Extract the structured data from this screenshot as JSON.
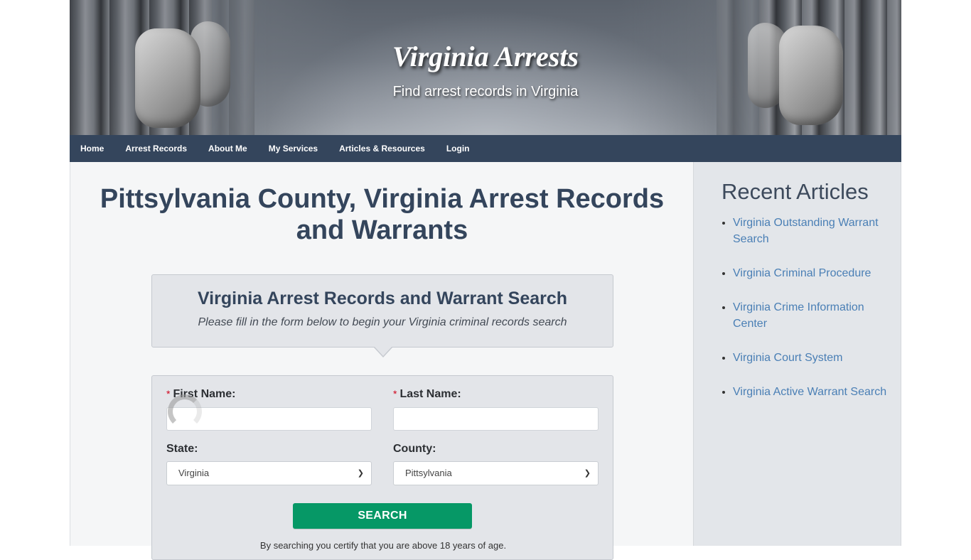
{
  "header": {
    "site_title": "Virginia Arrests",
    "tagline": "Find arrest records in Virginia"
  },
  "nav": {
    "items": [
      {
        "label": "Home"
      },
      {
        "label": "Arrest Records"
      },
      {
        "label": "About Me"
      },
      {
        "label": "My Services"
      },
      {
        "label": "Articles & Resources"
      },
      {
        "label": "Login"
      }
    ]
  },
  "main": {
    "page_title": "Pittsylvania County, Virginia Arrest Records and Warrants",
    "search_box": {
      "title": "Virginia Arrest Records and Warrant Search",
      "subtitle": "Please fill in the form below to begin your Virginia criminal records search"
    },
    "form": {
      "required_marker": "*",
      "first_name_label": "First Name:",
      "first_name_value": "",
      "last_name_label": "Last Name:",
      "last_name_value": "",
      "state_label": "State:",
      "state_selected": "Virginia",
      "county_label": "County:",
      "county_selected": "Pittsylvania",
      "search_button": "SEARCH",
      "disclaimer": "By searching you certify that you are above 18 years of age."
    }
  },
  "sidebar": {
    "title": "Recent Articles",
    "articles": [
      {
        "label": "Virginia Outstanding Warrant Search"
      },
      {
        "label": "Virginia Criminal Procedure"
      },
      {
        "label": "Virginia Crime Information Center"
      },
      {
        "label": "Virginia Court System"
      },
      {
        "label": "Virginia Active Warrant Search"
      }
    ]
  },
  "colors": {
    "nav_bg": "#34455c",
    "title_text": "#34455c",
    "search_button": "#069866",
    "link": "#4a7fb5",
    "required": "#d0021b"
  }
}
